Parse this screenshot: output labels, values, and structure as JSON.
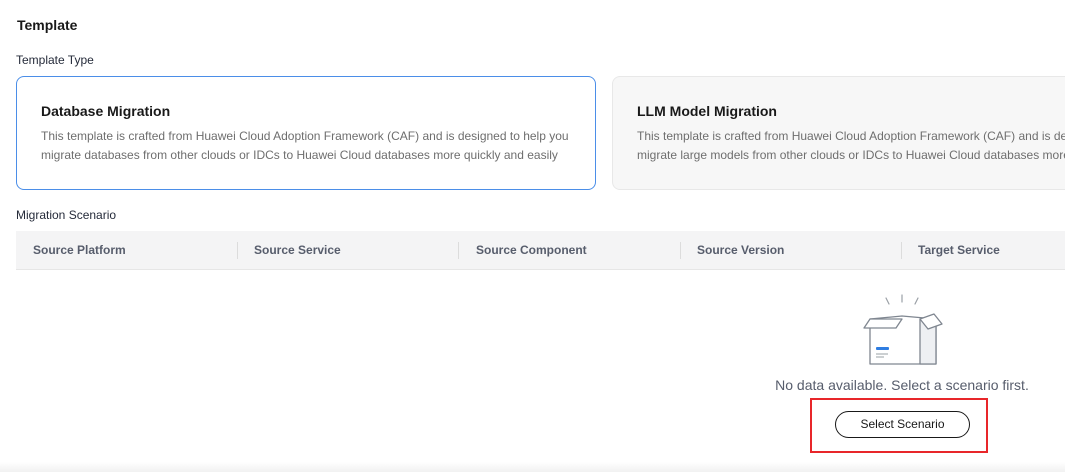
{
  "section": {
    "title": "Template"
  },
  "template_type": {
    "label": "Template Type",
    "cards": [
      {
        "title": "Database Migration",
        "description": "This template is crafted from Huawei Cloud Adoption Framework (CAF) and is designed to help you migrate databases from other clouds or IDCs to Huawei Cloud databases more quickly and easily",
        "selected": true
      },
      {
        "title": "LLM Model Migration",
        "description_line1": "This template is crafted from Huawei Cloud Adoption Framework (CAF) and is de",
        "description_line2": "migrate large models from other clouds or IDCs to Huawei Cloud databases more",
        "selected": false
      }
    ]
  },
  "migration_scenario": {
    "label": "Migration Scenario",
    "columns": [
      "Source Platform",
      "Source Service",
      "Source Component",
      "Source Version",
      "Target Service"
    ],
    "rows": [],
    "empty_text": "No data available. Select a scenario first.",
    "select_button_label": "Select Scenario"
  },
  "colors": {
    "selected_border": "#4b8ee8",
    "highlight": "#e8262a",
    "header_bg": "#f4f4f5"
  }
}
